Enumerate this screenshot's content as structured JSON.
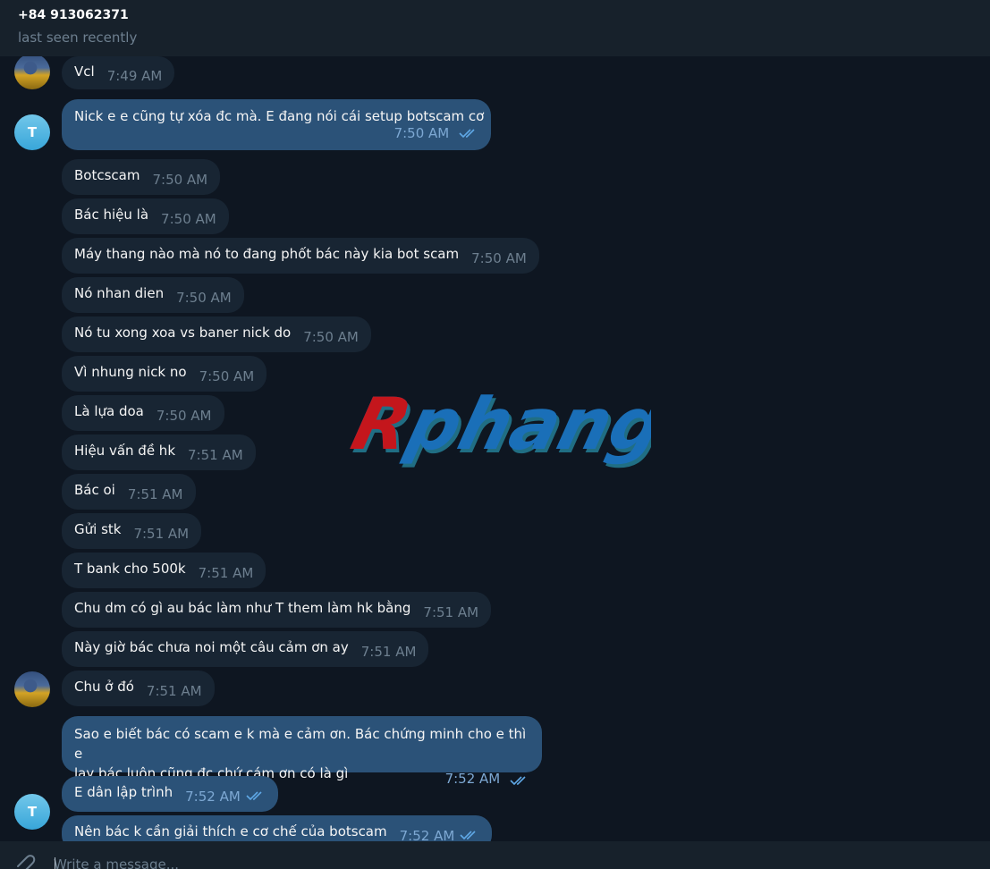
{
  "header": {
    "contact_name": "+84 913062371",
    "status": "last seen recently"
  },
  "avatars": {
    "contact_icon": "painting-avatar",
    "self_initial": "T"
  },
  "messages": [
    {
      "dir": "in",
      "text": "Vcl",
      "time": "7:49 AM"
    },
    {
      "dir": "out",
      "text": "Nick e e cũng tự xóa đc mà. E đang nói cái setup botscam cơ",
      "time": "7:50 AM",
      "read": true
    },
    {
      "dir": "in",
      "text": "Botcscam",
      "time": "7:50 AM"
    },
    {
      "dir": "in",
      "text": "Bác hiệu là",
      "time": "7:50 AM"
    },
    {
      "dir": "in",
      "text": "Máy thang nào mà nó to đang phốt bác này kia bot scam",
      "time": "7:50 AM"
    },
    {
      "dir": "in",
      "text": "Nó nhan dien",
      "time": "7:50 AM"
    },
    {
      "dir": "in",
      "text": "Nó tu xong xoa vs baner nick do",
      "time": "7:50 AM"
    },
    {
      "dir": "in",
      "text": "Vì nhung nick no",
      "time": "7:50 AM"
    },
    {
      "dir": "in",
      "text": "Là lựa doa",
      "time": "7:50 AM"
    },
    {
      "dir": "in",
      "text": "Hiệu vấn đề hk",
      "time": "7:51 AM"
    },
    {
      "dir": "in",
      "text": "Bác oi",
      "time": "7:51 AM"
    },
    {
      "dir": "in",
      "text": "Gửi stk",
      "time": "7:51 AM"
    },
    {
      "dir": "in",
      "text": "T bank cho 500k",
      "time": "7:51 AM"
    },
    {
      "dir": "in",
      "text": "Chu dm có gì au bác làm như T them làm hk bằng",
      "time": "7:51 AM"
    },
    {
      "dir": "in",
      "text": "Này giờ bác chưa noi một câu cảm ơn ay",
      "time": "7:51 AM"
    },
    {
      "dir": "in",
      "text": "Chu ở đó",
      "time": "7:51 AM"
    },
    {
      "dir": "out",
      "line1": "Sao e biết bác có scam e k mà e cảm ơn. Bác chứng minh cho e thì e",
      "line2": "lạy bác luôn cũng đc chứ cám ơn có là gì",
      "time": "7:52 AM",
      "read": true
    },
    {
      "dir": "out",
      "text": "E dân lập trình",
      "time": "7:52 AM",
      "read": true
    },
    {
      "dir": "out",
      "text": "Nên bác k cần giải thích e cơ chế của botscam",
      "time": "7:52 AM",
      "read": true
    }
  ],
  "watermark": {
    "text": "Rphang",
    "colors": {
      "first": "#c4161c",
      "rest": "#1a6fb8",
      "edge": "#2fb7d6"
    }
  },
  "composer": {
    "placeholder": "Write a message...",
    "attach_icon": "paperclip-icon"
  },
  "colors": {
    "background": "#0e1621",
    "header": "#17212b",
    "incoming_bubble": "#182533",
    "outgoing_bubble": "#2b5278",
    "read_check": "#5fa8e6"
  }
}
